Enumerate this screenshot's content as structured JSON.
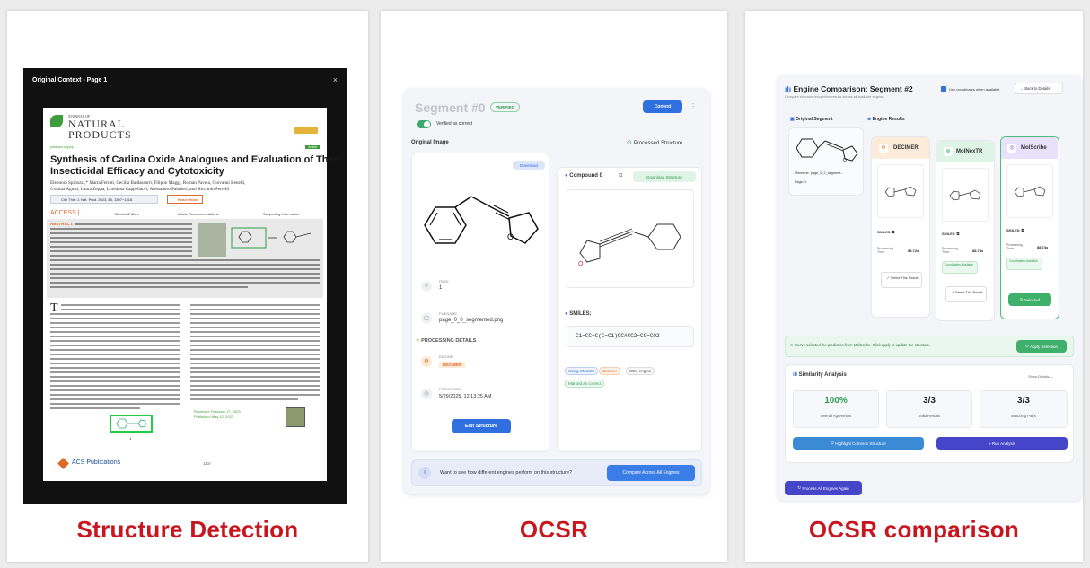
{
  "captions": {
    "p1": "Structure Detection",
    "p2": "OCSR",
    "p3": "OCSR comparison"
  },
  "detect": {
    "modal_title": "Original Context - Page 1",
    "close": "×",
    "journal_top": "JOURNAL OF",
    "journal_name1": "NATURAL",
    "journal_name2": "PRODUCTS",
    "doi": "pubs.acs.org/jnp",
    "article_badge": "Article",
    "title1": "Synthesis of Carlina Oxide Analogues and Evaluation of Their",
    "title2": "Insecticidal Efficacy and Cytotoxicity",
    "authors1": "Eleonora Spinozzi,* Marta Ferrati, Cecilia Baldassarri, Filippo Maggi, Roman Pavela, Giovanni Benelli,",
    "authors2": "Cristina Agustí, Laura Zeppa, Loredana Cappellacci, Alessandro Palmieri, and Riccardo Petrelli",
    "cite": "Cite This: J. Nat. Prod. 2023, 86, 1307−1316",
    "read": "Read Online",
    "access": "ACCESS |",
    "metrics": "Metrics & More",
    "recs": "Article Recommendations",
    "support": "Supporting Information",
    "abstract": "ABSTRACT:",
    "received": "Received:  February 17, 2023",
    "published": "Published:  May 12, 2023",
    "box_label": "1",
    "acs": "ACS Publications",
    "page_no": "1307"
  },
  "ocsr": {
    "segment": "Segment #0",
    "verified": "VERIFIED",
    "context": "Context",
    "verified_toggle": "Verified as correct",
    "original_image": "Original Image",
    "processed_structure": "Processed Structure",
    "download": "Download",
    "compound": "Compound 0",
    "download_structure": "Download Structure",
    "page_label": "PAGE",
    "page_value": "1",
    "filename_label": "FILENAME",
    "filename_value": "page_0_0_segmented.png",
    "processing_details": "PROCESSING DETAILS",
    "engine_label": "ENGINE",
    "engine_value": "DECIMER",
    "processed_label": "PROCESSED",
    "processed_value": "5/29/2025, 12:13:25 AM",
    "edit": "Edit Structure",
    "smiles_label": "SMILES:",
    "smiles_value": "C1=CC=C(C=C1)CC#CC2=CC=CO2",
    "tags": [
      "Using SMILES",
      "decimer",
      "CDK engine",
      "Marked as correct"
    ],
    "compare_text": "Want to see how different engines perform on this structure?",
    "compare_btn": "Compare Across All Engines"
  },
  "comp": {
    "title": "Engine Comparison: Segment #2",
    "subtitle": "Compare structure recognition results across all available engines",
    "use_coords": "Use coordinates when available",
    "back": "Back to Details",
    "original_segment": "Original Segment",
    "engine_results": "Engine Results",
    "filename": "Filename:  page_0_2_segment...",
    "page": "Page:  1",
    "engines": [
      {
        "name": "DECIMER",
        "smiles": "SMILES:",
        "time_label": "Processing Time:",
        "time": "88.72s",
        "action": "Select This Result",
        "color": "#ef7d2b",
        "bg": "#fdebd9"
      },
      {
        "name": "MolNexTR",
        "smiles": "SMILES:",
        "time_label": "Processing Time:",
        "time": "88.74s",
        "coord": "Coordinates Available",
        "action": "Select This Result",
        "color": "#2fb36a",
        "bg": "#dff4e6"
      },
      {
        "name": "MolScribe",
        "smiles": "SMILES:",
        "time_label": "Processing Time:",
        "time": "88.74s",
        "coord": "Coordinates Available",
        "action": "Selected",
        "color": "#7b4fd6",
        "bg": "#e9e1fb"
      }
    ],
    "notice": "You've selected the prediction from MolScribe. Click apply to update the structure.",
    "apply": "Apply Selection",
    "similarity": "Similarity Analysis",
    "show_details": "Show Details",
    "stats": [
      {
        "value": "100%",
        "label": "Overall Agreement",
        "color": "#2a9a4f"
      },
      {
        "value": "3/3",
        "label": "Valid Results",
        "color": "#222"
      },
      {
        "value": "3/3",
        "label": "Matching Pairs",
        "color": "#222"
      }
    ],
    "highlight": "Highlight Common Structure",
    "run": "Run Analysis",
    "process_again": "Process All Engines Again"
  }
}
